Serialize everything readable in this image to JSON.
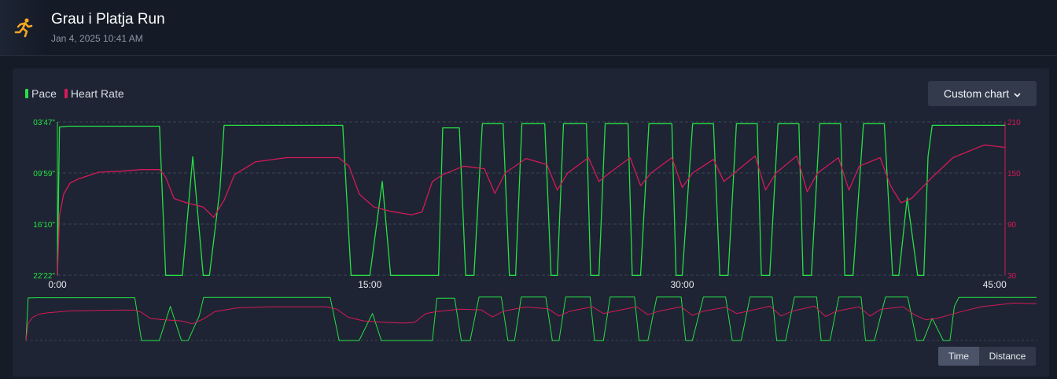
{
  "activity": {
    "title": "Grau i Platja Run",
    "datetime": "Jan 4, 2025 10:41 AM",
    "icon": "running-person-icon"
  },
  "legend": {
    "pace_label": "Pace",
    "heart_rate_label": "Heart Rate"
  },
  "custom_chart_label": "Custom chart",
  "toggle": {
    "time_label": "Time",
    "distance_label": "Distance",
    "selected": "Time"
  },
  "colors": {
    "pace": "#27e046",
    "heart_rate": "#d41a58",
    "accent_icon": "#f5a623"
  },
  "chart_data": {
    "type": "line",
    "x_ticks": [
      "0:00",
      "15:00",
      "30:00",
      "45:00"
    ],
    "x_range_minutes": [
      0,
      45.5
    ],
    "y_left_label": "Pace",
    "y_left_ticks": [
      "03'47\"",
      "09'59\"",
      "16'10\"",
      "22'22\""
    ],
    "y_right_label": "Heart Rate",
    "y_right_ticks": [
      "210",
      "150",
      "90",
      "30"
    ],
    "y_right_range": [
      30,
      210
    ],
    "grid": true,
    "series": [
      {
        "name": "Pace",
        "unit": "min/km",
        "t": [
          0,
          0.1,
          0.5,
          4.9,
          5.2,
          5.3,
          5.5,
          6.0,
          6.5,
          7.0,
          7.3,
          7.8,
          8.0,
          13.7,
          14.1,
          14.4,
          15.0,
          15.6,
          16.0,
          16.8,
          17.2,
          17.6,
          18.3,
          18.5,
          19.3,
          19.6,
          20.0,
          20.4,
          21.4,
          21.7,
          22.0,
          22.3,
          23.4,
          23.7,
          24.0,
          24.3,
          25.4,
          25.6,
          26.0,
          26.3,
          27.4,
          27.6,
          28.0,
          28.4,
          29.5,
          29.7,
          30.0,
          30.5,
          31.5,
          31.8,
          32.2,
          32.6,
          33.6,
          33.8,
          34.2,
          34.6,
          35.6,
          35.8,
          36.2,
          36.6,
          37.6,
          37.8,
          38.2,
          38.7,
          39.7,
          40.1,
          40.4,
          40.8,
          41.3,
          41.6,
          41.8,
          42.0,
          45.5
        ],
        "pace": [
          22.4,
          4.4,
          4.3,
          4.3,
          22.4,
          22.4,
          22.4,
          22.4,
          8.0,
          22.4,
          22.4,
          12.0,
          4.2,
          4.2,
          22.4,
          22.4,
          22.4,
          11.0,
          22.4,
          22.4,
          22.4,
          22.4,
          22.4,
          4.5,
          4.5,
          22.4,
          22.4,
          4.0,
          4.0,
          22.4,
          22.4,
          4.0,
          4.0,
          22.4,
          22.4,
          4.0,
          4.0,
          22.4,
          22.4,
          4.0,
          4.0,
          22.4,
          22.4,
          4.0,
          4.0,
          22.4,
          22.4,
          4.0,
          4.0,
          22.4,
          22.4,
          4.0,
          4.0,
          22.4,
          22.4,
          4.0,
          4.0,
          22.4,
          22.4,
          4.0,
          4.0,
          22.4,
          22.4,
          4.0,
          4.0,
          22.4,
          22.4,
          13.0,
          22.4,
          22.4,
          8.0,
          4.2,
          4.2
        ]
      },
      {
        "name": "Heart Rate",
        "unit": "bpm",
        "t": [
          0,
          0.1,
          0.3,
          0.6,
          1.0,
          2.0,
          3.0,
          4.0,
          4.9,
          5.2,
          5.6,
          6.2,
          7.0,
          7.5,
          8.0,
          8.5,
          9.5,
          11.0,
          13.5,
          14.0,
          14.5,
          15.2,
          16.0,
          17.0,
          17.5,
          18.0,
          18.5,
          19.5,
          20.5,
          21.0,
          21.5,
          22.5,
          23.5,
          24.0,
          24.5,
          25.5,
          26.0,
          26.5,
          27.5,
          28.0,
          28.5,
          29.5,
          30.0,
          30.5,
          31.5,
          32.0,
          32.5,
          33.5,
          34.0,
          34.5,
          35.5,
          36.0,
          36.5,
          37.5,
          38.0,
          38.5,
          39.5,
          40.0,
          40.5,
          41.0,
          42.0,
          43.0,
          44.5,
          45.5
        ],
        "hr": [
          30,
          100,
          125,
          138,
          143,
          151,
          152,
          154,
          154,
          145,
          120,
          115,
          110,
          98,
          118,
          148,
          163,
          168,
          168,
          158,
          125,
          110,
          105,
          101,
          104,
          140,
          148,
          158,
          155,
          126,
          150,
          167,
          160,
          130,
          150,
          168,
          140,
          150,
          168,
          135,
          150,
          168,
          133,
          150,
          166,
          140,
          150,
          170,
          130,
          150,
          170,
          128,
          150,
          168,
          130,
          158,
          168,
          135,
          115,
          120,
          145,
          168,
          183,
          180
        ]
      }
    ]
  }
}
